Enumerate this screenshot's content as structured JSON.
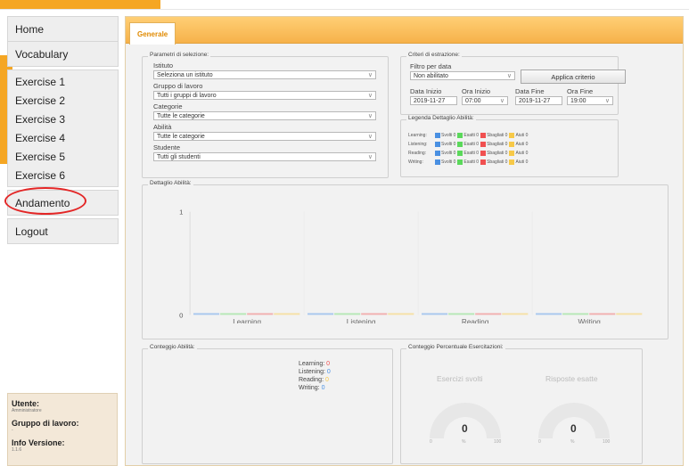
{
  "sidebar": {
    "items": [
      {
        "label": "Home"
      },
      {
        "label": "Vocabulary"
      },
      {
        "label": "Exercise 1"
      },
      {
        "label": "Exercise 2"
      },
      {
        "label": "Exercise 3"
      },
      {
        "label": "Exercise 4"
      },
      {
        "label": "Exercise 5"
      },
      {
        "label": "Exercise 6"
      },
      {
        "label": "Andamento"
      },
      {
        "label": "Logout"
      }
    ]
  },
  "user_info": {
    "user_label": "Utente:",
    "user_value": "Amministratore",
    "group_label": "Gruppo di lavoro:",
    "group_value": "-",
    "version_label": "Info Versione:",
    "version_value": "1.1.6"
  },
  "main": {
    "tab_label": "Generale",
    "selection": {
      "legend": "Parametri di selezione:",
      "istituto_label": "Istituto",
      "istituto_value": "Seleziona un istituto",
      "gruppo_label": "Gruppo di lavoro",
      "gruppo_value": "Tutti i gruppi di lavoro",
      "categorie_label": "Categorie",
      "categorie_value": "Tutte le categorie",
      "abilita_label": "Abilità",
      "abilita_value": "Tutte le categorie",
      "studente_label": "Studente",
      "studente_value": "Tutti gli studenti"
    },
    "criteria": {
      "legend": "Criteri di estrazione:",
      "filtro_label": "Filtro per data",
      "filtro_value": "Non abilitato",
      "apply_label": "Applica criterio",
      "data_inizio_label": "Data Inizio",
      "data_inizio_value": "2019-11-27",
      "ora_inizio_label": "Ora Inizio",
      "ora_inizio_value": "07:00",
      "data_fine_label": "Data Fine",
      "data_fine_value": "2019-11-27",
      "ora_fine_label": "Ora Fine",
      "ora_fine_value": "19:00"
    },
    "legend_panel": {
      "legend": "Legenda Dettaglio Abilità:",
      "rows": [
        {
          "skill": "Learning:",
          "svolti": "Svolti 0",
          "esatti": "Esatti 0",
          "sbagliati": "Sbagliati 0",
          "aiuti": "Aiuti 0"
        },
        {
          "skill": "Listening:",
          "svolti": "Svolti 0",
          "esatti": "Esatti 0",
          "sbagliati": "Sbagliati 0",
          "aiuti": "Aiuti 0"
        },
        {
          "skill": "Reading:",
          "svolti": "Svolti 0",
          "esatti": "Esatti 0",
          "sbagliati": "Sbagliati 0",
          "aiuti": "Aiuti 0"
        },
        {
          "skill": "Writing:",
          "svolti": "Svolti 0",
          "esatti": "Esatti 0",
          "sbagliati": "Sbagliati 0",
          "aiuti": "Aiuti 0"
        }
      ],
      "colors": {
        "svolti": "#4a90e2",
        "esatti": "#5bd85b",
        "sbagliati": "#f05050",
        "aiuti": "#f7c948"
      }
    },
    "detail_legend": "Dettaglio Abilità:",
    "conteggio": {
      "legend": "Conteggio Abilità:",
      "lines": [
        {
          "label": "Learning:",
          "value": "0",
          "color": "#f05050"
        },
        {
          "label": "Listening:",
          "value": "0",
          "color": "#4a90e2"
        },
        {
          "label": "Reading:",
          "value": "0",
          "color": "#f7c948"
        },
        {
          "label": "Writing:",
          "value": "0",
          "color": "#4a90e2"
        }
      ]
    },
    "percentuale": {
      "legend": "Conteggio Percentuale Esercitazioni:",
      "gauges": [
        {
          "title": "Esercizi svolti",
          "value": "0",
          "min": "0",
          "unit": "%",
          "max": "100"
        },
        {
          "title": "Risposte esatte",
          "value": "0",
          "min": "0",
          "unit": "%",
          "max": "100"
        }
      ]
    }
  },
  "chart_data": {
    "type": "bar",
    "categories": [
      "Learning",
      "Listening",
      "Reading",
      "Writing"
    ],
    "series": [
      {
        "name": "Svolti",
        "values": [
          0,
          0,
          0,
          0
        ]
      },
      {
        "name": "Esatti",
        "values": [
          0,
          0,
          0,
          0
        ]
      },
      {
        "name": "Sbagliati",
        "values": [
          0,
          0,
          0,
          0
        ]
      },
      {
        "name": "Aiuti",
        "values": [
          0,
          0,
          0,
          0
        ]
      }
    ],
    "yticks": [
      "0",
      "1"
    ],
    "ylim": [
      0,
      1
    ],
    "series_colors": [
      "#a9c8ee",
      "#b6e8b6",
      "#f1b0b0",
      "#f5e1a6"
    ]
  }
}
